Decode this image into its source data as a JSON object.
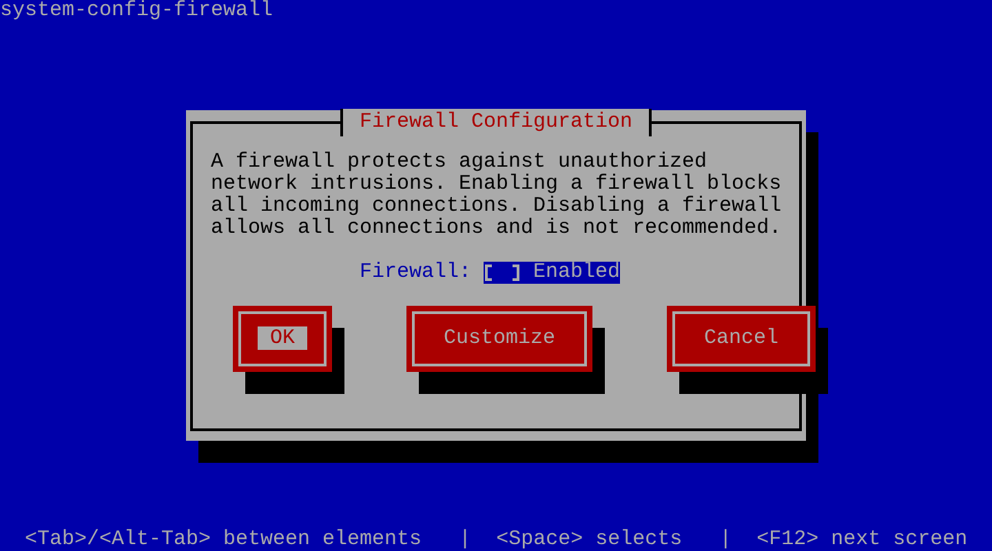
{
  "screen_title": "system-config-firewall",
  "dialog": {
    "title": "Firewall Configuration",
    "message": "A firewall protects against unauthorized network intrusions. Enabling a firewall blocks all incoming connections. Disabling a firewall allows all connections and is not recommended.",
    "field_label": "Firewall:",
    "checkbox": {
      "label": "Enabled",
      "checked": false
    },
    "buttons": [
      {
        "label": "OK",
        "selected": true
      },
      {
        "label": "Customize",
        "selected": false
      },
      {
        "label": "Cancel",
        "selected": false
      }
    ]
  },
  "status_bar": [
    {
      "kind": "hint",
      "text": "<Tab>/<Alt-Tab> between elements"
    },
    {
      "kind": "separator",
      "text": "|"
    },
    {
      "kind": "hint",
      "text": "<Space> selects"
    },
    {
      "kind": "separator",
      "text": "|"
    },
    {
      "kind": "hint",
      "text": "<F12> next screen"
    }
  ]
}
